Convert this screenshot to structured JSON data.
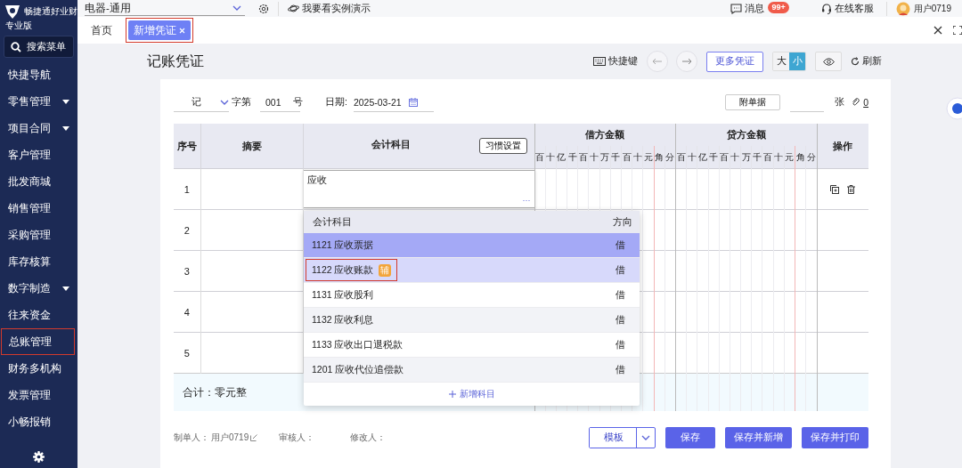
{
  "sidebar": {
    "brand": "畅捷通好业财",
    "edition": "专业版",
    "search": "搜索菜单",
    "items": [
      {
        "label": "快捷导航",
        "expandable": false,
        "highlighted": false
      },
      {
        "label": "零售管理",
        "expandable": true,
        "highlighted": false
      },
      {
        "label": "项目合同",
        "expandable": true,
        "highlighted": false
      },
      {
        "label": "客户管理",
        "expandable": false,
        "highlighted": false
      },
      {
        "label": "批发商城",
        "expandable": false,
        "highlighted": false
      },
      {
        "label": "销售管理",
        "expandable": false,
        "highlighted": false
      },
      {
        "label": "采购管理",
        "expandable": false,
        "highlighted": false
      },
      {
        "label": "库存核算",
        "expandable": false,
        "highlighted": false
      },
      {
        "label": "数字制造",
        "expandable": true,
        "highlighted": false
      },
      {
        "label": "往来资金",
        "expandable": false,
        "highlighted": false
      },
      {
        "label": "总账管理",
        "expandable": false,
        "highlighted": true
      },
      {
        "label": "财务多机构",
        "expandable": false,
        "highlighted": false
      },
      {
        "label": "发票管理",
        "expandable": false,
        "highlighted": false
      },
      {
        "label": "小畅报销",
        "expandable": false,
        "highlighted": false
      }
    ]
  },
  "topbar": {
    "org": "电器-通用",
    "demo": "我要看实例演示",
    "messages": "消息",
    "badge": "99+",
    "service": "在线客服",
    "user": "用户0719"
  },
  "tabs": [
    {
      "label": "首页",
      "selected": false,
      "highlighted": false,
      "closable": false
    },
    {
      "label": "新增凭证",
      "selected": true,
      "highlighted": true,
      "closable": true
    }
  ],
  "page": {
    "title": "记账凭证",
    "shortcuts": "快捷键",
    "more": "更多凭证",
    "sizes": [
      {
        "label": "大",
        "selected": false
      },
      {
        "label": "小",
        "selected": true
      }
    ],
    "refresh": "刷新"
  },
  "voucher": {
    "type": "记",
    "prefix": "字第",
    "number": "001",
    "suffix": "号",
    "date_label": "日期:",
    "date": "2025-03-21",
    "attach_button": "附单据",
    "attach_unit": "张",
    "attachments": "0"
  },
  "table": {
    "index_header": "序号",
    "summary_header": "摘要",
    "account_header": "会计科目",
    "habit_button": "习惯设置",
    "debit_header": "借方金额",
    "credit_header": "贷方金额",
    "actions_header": "操作",
    "debit_digits": [
      "百",
      "十",
      "亿",
      "千",
      "百",
      "十",
      "万",
      "千",
      "百",
      "十",
      "元",
      "角",
      "分"
    ],
    "credit_digits": [
      "百",
      "十",
      "亿",
      "千",
      "百",
      "十",
      "万",
      "千",
      "百",
      "十",
      "元",
      "角",
      "分"
    ],
    "rows": [
      {
        "index": "1",
        "editing": true,
        "account": "应收",
        "more": "···",
        "hovered": true
      },
      {
        "index": "2",
        "editing": false,
        "hovered": false
      },
      {
        "index": "3",
        "editing": false,
        "hovered": false
      },
      {
        "index": "4",
        "editing": false,
        "hovered": false
      },
      {
        "index": "5",
        "editing": false,
        "hovered": false
      }
    ],
    "total": "合计：零元整"
  },
  "dropdown": {
    "account_header": "会计科目",
    "direction_header": "方向",
    "rows": [
      {
        "account": "1121 应收票据",
        "direction": "借",
        "selected": true,
        "hovered": false,
        "highlighted": false
      },
      {
        "account": "1122 应收账款",
        "tag": "辅",
        "direction": "借",
        "selected": false,
        "hovered": true,
        "highlighted": true
      },
      {
        "account": "1131 应收股利",
        "direction": "借",
        "selected": false,
        "hovered": false,
        "highlighted": false
      },
      {
        "account": "1132 应收利息",
        "direction": "借",
        "selected": false,
        "hovered": false,
        "highlighted": false
      },
      {
        "account": "1133 应收出口退税款",
        "direction": "借",
        "selected": false,
        "hovered": false,
        "highlighted": false
      },
      {
        "account": "1201 应收代位追偿款",
        "direction": "借",
        "selected": false,
        "hovered": false,
        "highlighted": false
      }
    ],
    "add": "新增科目"
  },
  "footer": {
    "maker_label": "制单人：",
    "maker": "用户0719",
    "reviewer_label": "审核人：",
    "modifier_label": "修改人：",
    "buttons": [
      {
        "label": "模板",
        "kind": "split"
      },
      {
        "label": "保存",
        "kind": "primary"
      },
      {
        "label": "保存并新增",
        "kind": "primary"
      },
      {
        "label": "保存并打印",
        "kind": "primary"
      }
    ]
  }
}
